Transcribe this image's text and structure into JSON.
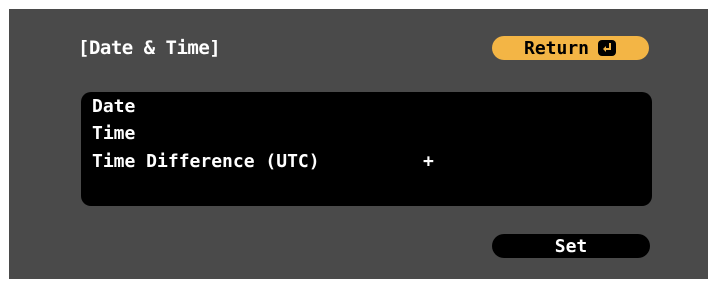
{
  "dialog": {
    "title": "[Date & Time]",
    "return_label": "Return",
    "return_icon": "enter-icon",
    "set_label": "Set"
  },
  "settings": {
    "rows": [
      {
        "label": "Date",
        "value": ""
      },
      {
        "label": "Time",
        "value": ""
      },
      {
        "label": "Time Difference (UTC)",
        "value": "+"
      },
      {
        "label": "",
        "value": ""
      }
    ]
  },
  "colors": {
    "background": "#4a4a4a",
    "list_background": "#000000",
    "accent_button": "#f3b545",
    "text": "#ffffff"
  }
}
